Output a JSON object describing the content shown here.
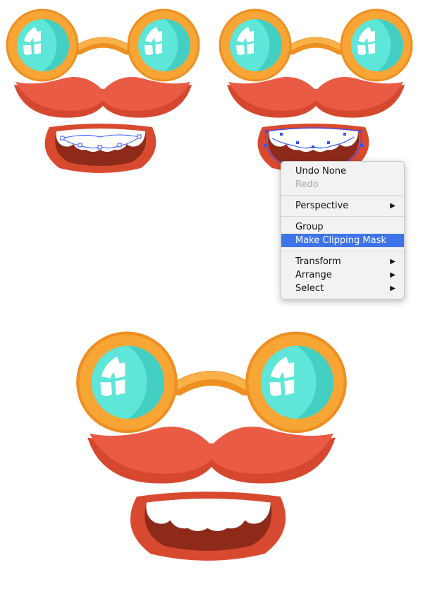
{
  "colors": {
    "frame": "#f7a534",
    "frame_dark": "#ee8f22",
    "lens": "#5ee6d9",
    "lens_shade": "#43cfc1",
    "mustache": "#ea5b45",
    "mustache_dark": "#d5482f",
    "lips": "#d84a30",
    "mouth": "#8e2a1a",
    "teeth": "#ffffff",
    "selection": "#3552ff",
    "menu_highlight": "#3f74e8"
  },
  "context_menu": {
    "undo": "Undo None",
    "redo": "Redo",
    "perspective": "Perspective",
    "group": "Group",
    "make_clipping_mask": "Make Clipping Mask",
    "transform": "Transform",
    "arrange": "Arrange",
    "select": "Select",
    "submenu_arrow": "▶"
  }
}
